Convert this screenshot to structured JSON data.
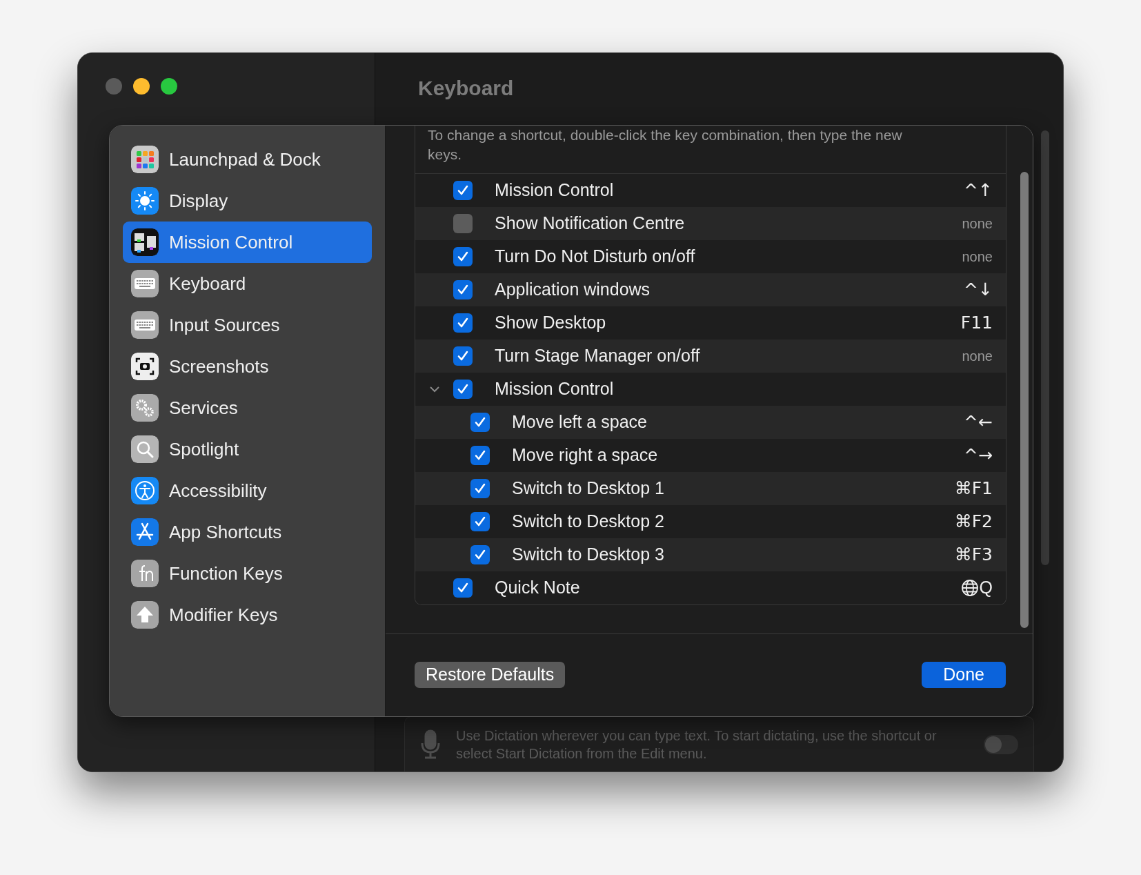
{
  "window": {
    "title": "Keyboard"
  },
  "sidebar": {
    "items": [
      {
        "label": "Launchpad & Dock",
        "selected": false
      },
      {
        "label": "Display",
        "selected": false
      },
      {
        "label": "Mission Control",
        "selected": true
      },
      {
        "label": "Keyboard",
        "selected": false
      },
      {
        "label": "Input Sources",
        "selected": false
      },
      {
        "label": "Screenshots",
        "selected": false
      },
      {
        "label": "Services",
        "selected": false
      },
      {
        "label": "Spotlight",
        "selected": false
      },
      {
        "label": "Accessibility",
        "selected": false
      },
      {
        "label": "App Shortcuts",
        "selected": false
      },
      {
        "label": "Function Keys",
        "selected": false
      },
      {
        "label": "Modifier Keys",
        "selected": false
      }
    ]
  },
  "sheet": {
    "description": "To change a shortcut, double-click the key combination, then type the new keys.",
    "shortcuts": [
      {
        "label": "Mission Control",
        "checked": true,
        "shortcut": {
          "kind": "keys",
          "text": "^↑"
        }
      },
      {
        "label": "Show Notification Centre",
        "checked": false,
        "shortcut": {
          "kind": "empty",
          "text": "none"
        }
      },
      {
        "label": "Turn Do Not Disturb on/off",
        "checked": true,
        "shortcut": {
          "kind": "empty",
          "text": "none"
        }
      },
      {
        "label": "Application windows",
        "checked": true,
        "shortcut": {
          "kind": "keys",
          "text": "^↓"
        }
      },
      {
        "label": "Show Desktop",
        "checked": true,
        "shortcut": {
          "kind": "keys",
          "text": "F11"
        }
      },
      {
        "label": "Turn Stage Manager on/off",
        "checked": true,
        "shortcut": {
          "kind": "empty",
          "text": "none"
        }
      },
      {
        "label": "Mission Control",
        "checked": true,
        "expanded": true,
        "children": [
          {
            "label": "Move left a space",
            "checked": true,
            "shortcut": {
              "kind": "keys",
              "text": "^←"
            }
          },
          {
            "label": "Move right a space",
            "checked": true,
            "shortcut": {
              "kind": "keys",
              "text": "^→"
            }
          },
          {
            "label": "Switch to Desktop 1",
            "checked": true,
            "shortcut": {
              "kind": "keys",
              "text": "⌘F1"
            }
          },
          {
            "label": "Switch to Desktop 2",
            "checked": true,
            "shortcut": {
              "kind": "keys",
              "text": "⌘F2"
            }
          },
          {
            "label": "Switch to Desktop 3",
            "checked": true,
            "shortcut": {
              "kind": "keys",
              "text": "⌘F3"
            }
          }
        ]
      },
      {
        "label": "Quick Note",
        "checked": true,
        "shortcut": {
          "kind": "globe",
          "text": "Q"
        }
      }
    ],
    "buttons": [
      {
        "label": "Restore Defaults",
        "kind": "secondary"
      },
      {
        "label": "Done",
        "kind": "primary"
      }
    ]
  },
  "dictation": {
    "text": "Use Dictation wherever you can type text. To start dictating, use the shortcut or select Start Dictation from the Edit menu.",
    "on": false
  }
}
